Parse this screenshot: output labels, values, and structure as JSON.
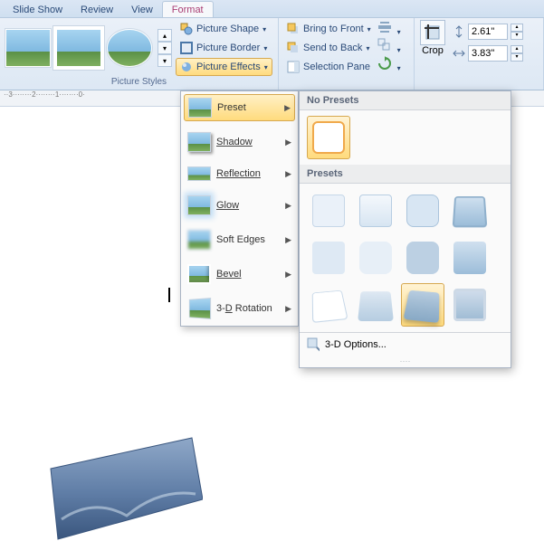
{
  "tabs": {
    "slideshow": "Slide Show",
    "review": "Review",
    "view": "View",
    "format": "Format"
  },
  "ribbon": {
    "picture_styles_label": "Picture Styles",
    "shape": "Picture Shape",
    "border": "Picture Border",
    "effects": "Picture Effects",
    "bring_front": "Bring to Front",
    "send_back": "Send to Back",
    "selection_pane": "Selection Pane",
    "crop": "Crop",
    "height_value": "2.61\"",
    "width_value": "3.83\""
  },
  "ruler_text": "··3········2········1········0·",
  "watermark": "",
  "effects_menu": {
    "preset": "Preset",
    "shadow": "Shadow",
    "reflection": "Reflection",
    "glow": "Glow",
    "soft_edges": "Soft Edges",
    "bevel": "Bevel",
    "rotation": "3-D Rotation"
  },
  "flyout": {
    "no_presets": "No Presets",
    "presets": "Presets",
    "options": "3-D Options...",
    "handle": "····"
  }
}
